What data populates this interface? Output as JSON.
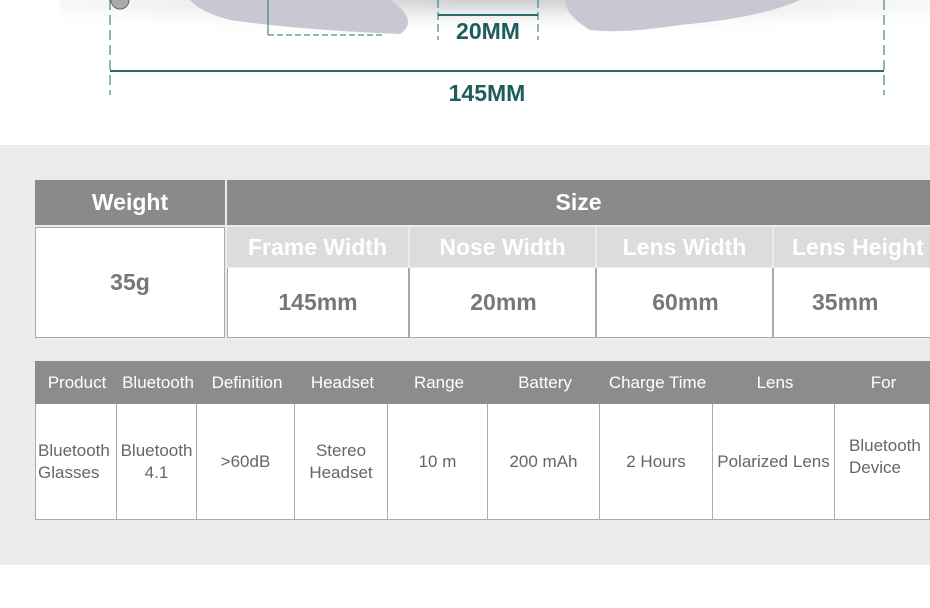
{
  "diagram": {
    "nose_width_label": "20MM",
    "frame_width_label": "145MM",
    "line_color": "#2a6b6b"
  },
  "size_table": {
    "weight_header": "Weight",
    "weight_value": "35g",
    "size_header": "Size",
    "columns": [
      {
        "label": "Frame Width",
        "value": "145mm"
      },
      {
        "label": "Nose Width",
        "value": "20mm"
      },
      {
        "label": "Lens Width",
        "value": "60mm"
      },
      {
        "label": "Lens Height",
        "value": "35mm"
      }
    ]
  },
  "spec_table": {
    "headers": [
      "Product",
      "Bluetooth",
      "Definition",
      "Headset",
      "Range",
      "Battery",
      "Charge Time",
      "Lens",
      "For"
    ],
    "values": [
      "Bluetooth Glasses",
      "Bluetooth 4.1",
      ">60dB",
      "Stereo Headset",
      "10 m",
      "200 mAh",
      "2 Hours",
      "Polarized Lens",
      "Bluetooth Device"
    ]
  },
  "colors": {
    "header_gray": "#8a8a8a",
    "subheader_gray": "#dcdcdc",
    "background": "#ebebeb"
  }
}
